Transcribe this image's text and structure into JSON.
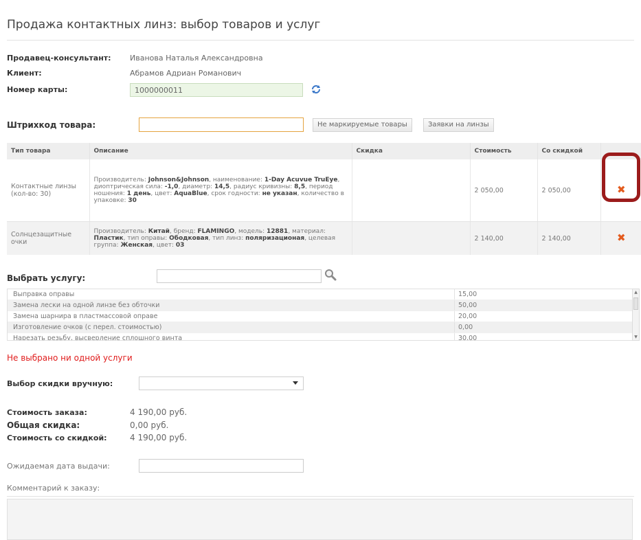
{
  "page": {
    "title": "Продажа контактных линз: выбор товаров и услуг"
  },
  "info": {
    "seller_label": "Продавец-консультант:",
    "seller_value": "Иванова Наталья Александровна",
    "client_label": "Клиент:",
    "client_value": "Абрамов Адриан Романович",
    "card_label": "Номер карты:",
    "card_value": "1000000011"
  },
  "barcode": {
    "label": "Штрихкод товара:",
    "value": "",
    "btn_unmarked": "Не маркируемые товары",
    "btn_orders": "Заявки на линзы"
  },
  "products": {
    "headers": [
      "Тип товара",
      "Описание",
      "Скидка",
      "Стоимость",
      "Со скидкой"
    ],
    "rows": [
      {
        "type": "Контактные линзы (кол-во: 30)",
        "desc": [
          {
            "t": "Производитель: ",
            "b": false
          },
          {
            "t": "Johnson&Johnson",
            "b": true
          },
          {
            "t": ", наименование: ",
            "b": false
          },
          {
            "t": "1-Day Acuvue TruEye",
            "b": true
          },
          {
            "t": ", диоптрическая сила: ",
            "b": false
          },
          {
            "t": "-1,0",
            "b": true
          },
          {
            "t": ", диаметр: ",
            "b": false
          },
          {
            "t": "14,5",
            "b": true
          },
          {
            "t": ", радиус кривизны: ",
            "b": false
          },
          {
            "t": "8,5",
            "b": true
          },
          {
            "t": ", период ношения: ",
            "b": false
          },
          {
            "t": "1 день",
            "b": true
          },
          {
            "t": ", цвет: ",
            "b": false
          },
          {
            "t": "AquaBlue",
            "b": true
          },
          {
            "t": ", срок годности: ",
            "b": false
          },
          {
            "t": "не указан",
            "b": true
          },
          {
            "t": ", количество в упаковке: ",
            "b": false
          },
          {
            "t": "30",
            "b": true
          }
        ],
        "discount": "",
        "price": "2 050,00",
        "discounted": "2 050,00"
      },
      {
        "type": "Солнцезащитные очки",
        "desc": [
          {
            "t": "Производитель: ",
            "b": false
          },
          {
            "t": "Китай",
            "b": true
          },
          {
            "t": ", бренд: ",
            "b": false
          },
          {
            "t": "FLAMINGO",
            "b": true
          },
          {
            "t": ", модель: ",
            "b": false
          },
          {
            "t": "12881",
            "b": true
          },
          {
            "t": ", материал: ",
            "b": false
          },
          {
            "t": "Пластик",
            "b": true
          },
          {
            "t": ", тип оправы: ",
            "b": false
          },
          {
            "t": "Ободковая",
            "b": true
          },
          {
            "t": ", тип линз: ",
            "b": false
          },
          {
            "t": "поляризационая",
            "b": true
          },
          {
            "t": ", целевая группа: ",
            "b": false
          },
          {
            "t": "Женская",
            "b": true
          },
          {
            "t": ", цвет: ",
            "b": false
          },
          {
            "t": "03",
            "b": true
          }
        ],
        "discount": "",
        "price": "2 140,00",
        "discounted": "2 140,00"
      }
    ],
    "delete_icon": "delete-cross-icon"
  },
  "services": {
    "label": "Выбрать услугу:",
    "search_value": "",
    "items": [
      {
        "name": "Выправка оправы",
        "price": "15,00"
      },
      {
        "name": "Замена лески на одной линзе без обточки",
        "price": "50,00"
      },
      {
        "name": "Замена шарнира в пластмассовой оправе",
        "price": "20,00"
      },
      {
        "name": "Изготовление очков (с перел. стоимостью)",
        "price": "0,00"
      },
      {
        "name": "Нарезать резьбу, высверление сплошного винта",
        "price": "30,00"
      }
    ],
    "empty_message": "Не выбрано ни одной услуги"
  },
  "discount": {
    "label": "Выбор скидки вручную:",
    "selected": ""
  },
  "summary": {
    "order_cost_label": "Стоимость заказа:",
    "order_cost_value": "4 190,00 руб.",
    "total_discount_label": "Общая скидка:",
    "total_discount_value": "0,00 руб.",
    "discounted_cost_label": "Стоимость со скидкой:",
    "discounted_cost_value": "4 190,00 руб."
  },
  "delivery": {
    "label": "Ожидаемая дата выдачи:",
    "value": ""
  },
  "comment": {
    "label": "Комментарий к заказу:",
    "value": ""
  },
  "colors": {
    "accent_delete": "#e35b1e",
    "highlight_border": "#9b1b1b",
    "error": "#e01b1b",
    "barcode_border": "#e5a33e"
  }
}
